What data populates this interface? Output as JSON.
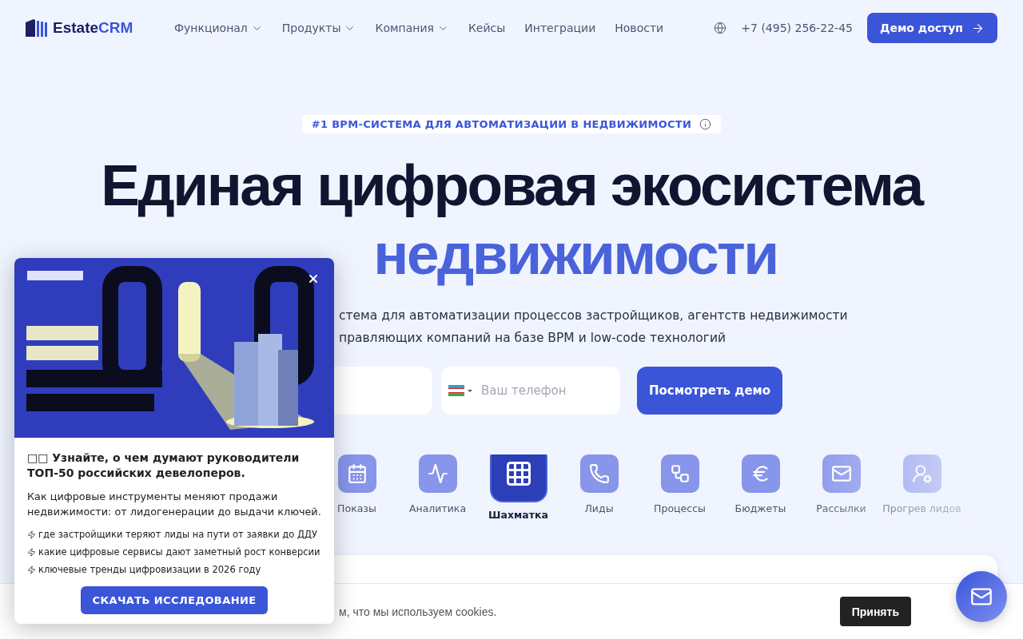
{
  "nav": {
    "logo": {
      "part1": "Estate",
      "part2": "CRM"
    },
    "links": [
      {
        "label": "Функционал",
        "dropdown": true
      },
      {
        "label": "Продукты",
        "dropdown": true
      },
      {
        "label": "Компания",
        "dropdown": true
      },
      {
        "label": "Кейсы",
        "dropdown": false
      },
      {
        "label": "Интеграции",
        "dropdown": false
      },
      {
        "label": "Новости",
        "dropdown": false
      }
    ],
    "phone": "+7 (495) 256-22-45",
    "cta": "Демо доступ"
  },
  "hero": {
    "badge": "#1 BPM-СИСТЕМА ДЛЯ АВТОМАТИЗАЦИИ В НЕДВИЖИМОСТИ",
    "title_line1": "Единая цифровая экосистема",
    "title_line2": "недвижимости",
    "subtitle": [
      "стема для автоматизации процессов застройщиков, агентств недвижимости",
      "правляющих компаний на базе BPM и low-code технологий"
    ],
    "phone_placeholder": "Ваш телефон",
    "submit": "Посмотреть демо"
  },
  "features": [
    {
      "label": "Показы",
      "selected": false
    },
    {
      "label": "Аналитика",
      "selected": false
    },
    {
      "label": "Шахматка",
      "selected": true
    },
    {
      "label": "Лиды",
      "selected": false
    },
    {
      "label": "Процессы",
      "selected": false
    },
    {
      "label": "Бюджеты",
      "selected": false
    },
    {
      "label": "Рассылки",
      "selected": false
    },
    {
      "label": "Прогрев лидов",
      "selected": false
    }
  ],
  "popup": {
    "heading": "□□ Узнайте, о чем думают руководители ТОП-50 российских девелоперов.",
    "text": "Как цифровые инструменты меняют продажи недвижимости: от лидогенерации до выдачи ключей.",
    "bullets": [
      "где застройщики теряют лиды на пути от заявки до ДДУ",
      "какие цифровые сервисы дают заметный рост конверсии",
      "ключевые тренды цифровизации в 2026 году"
    ],
    "button": "СКАЧАТЬ ИССЛЕДОВАНИЕ"
  },
  "cookies": {
    "text": "м, что мы используем cookies.",
    "button": "Принять"
  }
}
